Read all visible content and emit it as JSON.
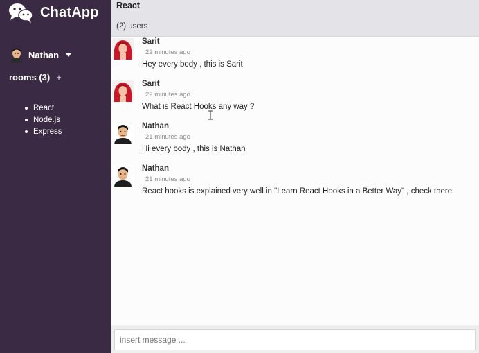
{
  "app": {
    "name": "ChatApp",
    "logo_icon": "wechat-bubbles-icon"
  },
  "sidebar": {
    "user": {
      "name": "Nathan",
      "avatar_icon": "cartoon-man-avatar-icon",
      "menu_icon": "caret-down-icon"
    },
    "rooms_label": "rooms (3)",
    "add_room_label": "+",
    "rooms": [
      {
        "label": "React"
      },
      {
        "label": "Node.js"
      },
      {
        "label": "Express"
      }
    ],
    "colors": {
      "background": "#3a2a43",
      "text": "#ffffff"
    }
  },
  "header": {
    "room_title": "React",
    "user_count": "(2) users",
    "background": "#e4e3e8"
  },
  "messages": [
    {
      "author": "Sarit",
      "time": "22 minutes ago",
      "text": "Hey every body , this is Sarit",
      "avatar_icon": "red-hair-woman-avatar-icon"
    },
    {
      "author": "Sarit",
      "time": "22 minutes ago",
      "text": "What is React Hooks any way ?",
      "avatar_icon": "red-hair-woman-avatar-icon"
    },
    {
      "author": "Nathan",
      "time": "21 minutes ago",
      "text": "Hi every body , this is Nathan",
      "avatar_icon": "cartoon-man-avatar-icon"
    },
    {
      "author": "Nathan",
      "time": "21 minutes ago",
      "text": "React hooks is explained very well in \"Learn React Hooks in a Better Way\" , check there",
      "avatar_icon": "cartoon-man-avatar-icon"
    }
  ],
  "composer": {
    "placeholder": "insert message ...",
    "value": ""
  }
}
